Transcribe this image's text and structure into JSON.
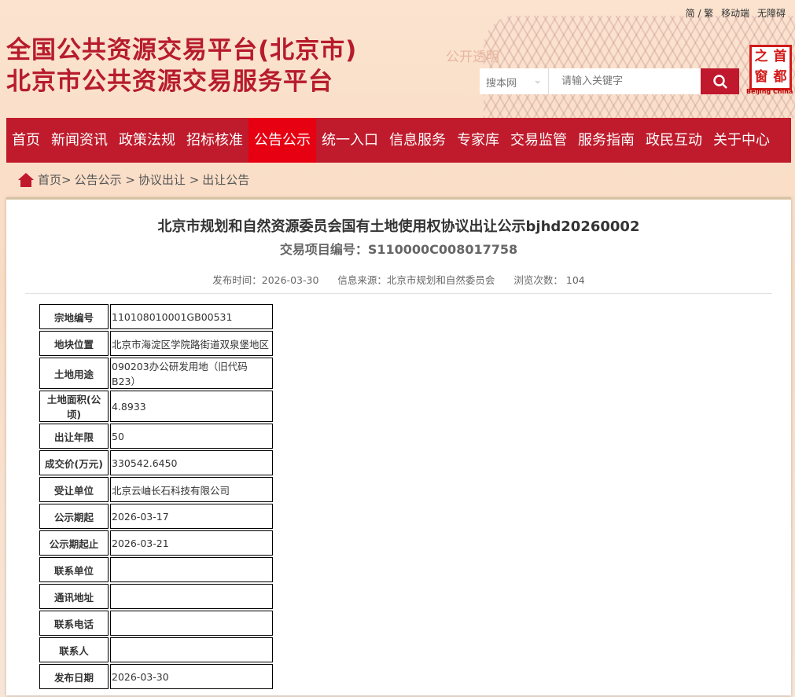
{
  "top_links": [
    "简 / 繁",
    "移动端",
    "无障碍"
  ],
  "site_title_1": "全国公共资源交易平台(北京市)",
  "site_title_2": "北京市公共资源交易服务平台",
  "slogan": "公开透明",
  "search": {
    "scope": "搜本网",
    "placeholder": "请输入关键字"
  },
  "seal": {
    "chars": [
      "之",
      "首",
      "窗",
      "都"
    ],
    "sub": "Beijing China"
  },
  "nav": [
    "首页",
    "新闻资讯",
    "政策法规",
    "招标核准",
    "公告公示",
    "统一入口",
    "信息服务",
    "专家库",
    "交易监管",
    "服务指南",
    "政民互动",
    "关于中心"
  ],
  "nav_active": 4,
  "breadcrumb": [
    "首页>",
    "公告公示 >",
    "协议出让 >",
    "出让公告"
  ],
  "article": {
    "title": "北京市规划和自然资源委员会国有土地使用权协议出让公示bjhd20260002",
    "subtitle": "交易项目编号：S110000C008017758",
    "publish": "发布时间：2026-03-30",
    "source": "信息来源：北京市规划和自然委员会",
    "views": "浏览次数：  104"
  },
  "table": [
    [
      "宗地编号",
      "110108010001GB00531"
    ],
    [
      "地块位置",
      "北京市海淀区学院路街道双泉堡地区"
    ],
    [
      "土地用途",
      "090203办公研发用地（旧代码B23）"
    ],
    [
      "土地面积(公顷)",
      "4.8933"
    ],
    [
      "出让年限",
      "50"
    ],
    [
      "成交价(万元)",
      "330542.6450"
    ],
    [
      "受让单位",
      "北京云岫长石科技有限公司"
    ],
    [
      "公示期起",
      "2026-03-17"
    ],
    [
      "公示期起止",
      "2026-03-21"
    ],
    [
      "联系单位",
      ""
    ],
    [
      "通讯地址",
      ""
    ],
    [
      "联系电话",
      ""
    ],
    [
      "联系人",
      ""
    ],
    [
      "发布日期",
      "2026-03-30"
    ]
  ]
}
